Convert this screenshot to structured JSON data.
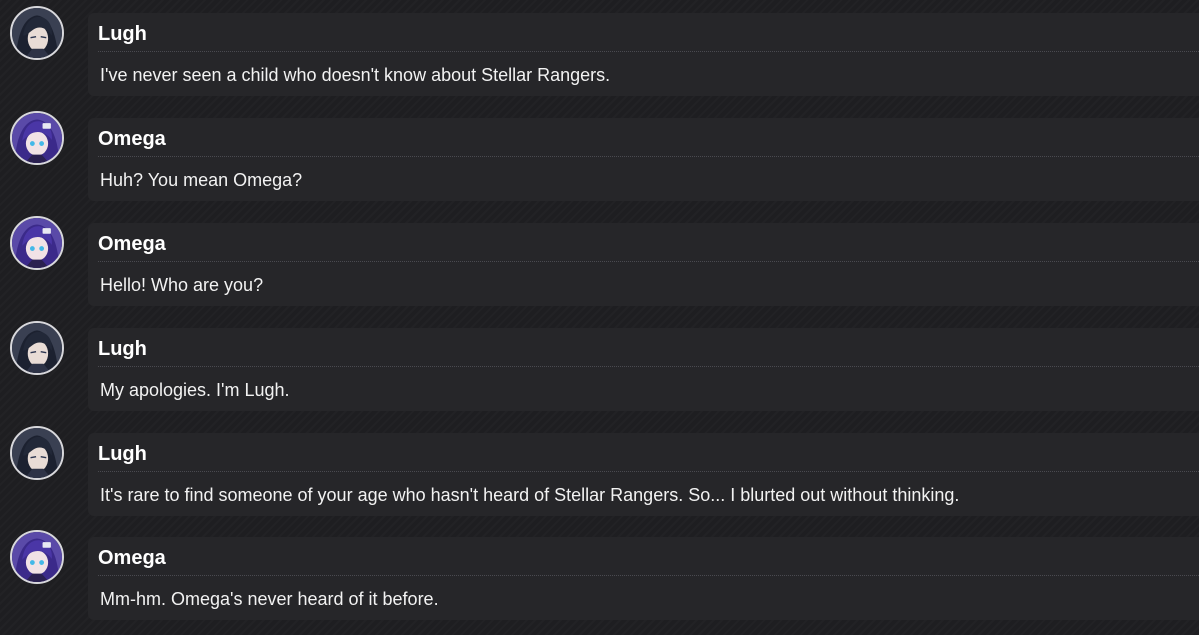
{
  "messages": [
    {
      "speaker": "Lugh",
      "avatar_icon": "lugh-avatar-icon",
      "text": "I've never seen a child who doesn't know about Stellar Rangers."
    },
    {
      "speaker": "Omega",
      "avatar_icon": "omega-avatar-icon",
      "text": "Huh? You mean Omega?"
    },
    {
      "speaker": "Omega",
      "avatar_icon": "omega-avatar-icon",
      "text": "Hello! Who are you?"
    },
    {
      "speaker": "Lugh",
      "avatar_icon": "lugh-avatar-icon",
      "text": "My apologies. I'm Lugh."
    },
    {
      "speaker": "Lugh",
      "avatar_icon": "lugh-avatar-icon",
      "text": "It's rare to find someone of your age who hasn't heard of Stellar Rangers. So... I blurted out without thinking."
    },
    {
      "speaker": "Omega",
      "avatar_icon": "omega-avatar-icon",
      "text": "Mm-hm. Omega's never heard of it before."
    }
  ],
  "colors": {
    "background": "#1e1e21",
    "bubble": "#262629",
    "text": "#f2f2f2",
    "avatar_ring": "#d8d8dc"
  }
}
